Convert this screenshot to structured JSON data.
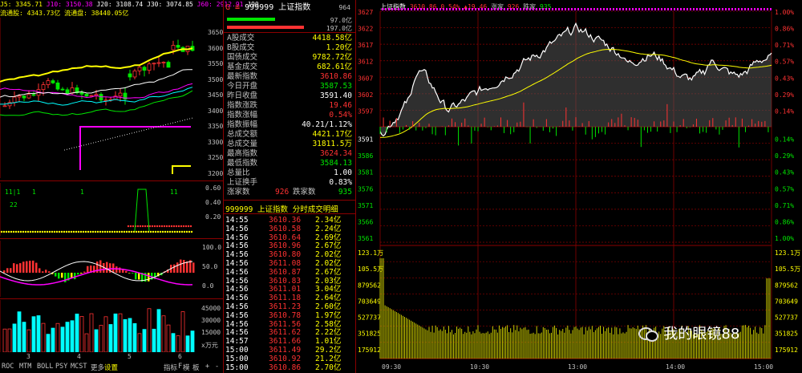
{
  "left_chart": {
    "header": {
      "items": [
        {
          "text": "J5: 3345.71",
          "color": "#ffff00"
        },
        {
          "text": "J10: 3150.38",
          "color": "#ff00ff"
        },
        {
          "text": "J20: 3108.74",
          "color": "#ffffff"
        },
        {
          "text": "J30: 3074.85",
          "color": "#ffffff"
        },
        {
          "text": "J60: 2912.91",
          "color": "#ff00ff"
        },
        {
          "text": "J90",
          "color": "#ffffff"
        }
      ],
      "line2": [
        {
          "text": "流通股: 4343.73亿",
          "color": "#ffff00"
        },
        {
          "text": "流通盘: 38440.05亿",
          "color": "#ffff00"
        }
      ]
    },
    "price_axis": [
      "3650",
      "3600",
      "3550",
      "3500",
      "3450",
      "3400",
      "3350",
      "3300",
      "3250",
      "3200"
    ],
    "kdj_axis": [
      "0.60",
      "0.40",
      "0.20"
    ],
    "kdj_markers": [
      "11|1",
      "22",
      "1",
      "11",
      "1"
    ],
    "macd_axis": [
      "100.0",
      "50.0",
      "0.0"
    ],
    "vol_axis": [
      "45000",
      "30000",
      "15000",
      "x万元"
    ],
    "month_ticks": [
      "3",
      "4",
      "5",
      "6"
    ],
    "bottom_tabs": [
      "ROC",
      "MTM",
      "BOLL",
      "PSY",
      "MCST",
      "更多",
      "设置"
    ],
    "right_tabs": [
      "指标",
      "F",
      "模",
      "板",
      "+",
      "-"
    ]
  },
  "quote_panel": {
    "title_code": "999999",
    "title_name": "上证指数",
    "title_prefix": "G ≡",
    "title_badge": "964",
    "bar_labels": [
      "97.0亿",
      "197.0亿"
    ],
    "rows": [
      {
        "label": "A股成交",
        "value": "4418.58亿",
        "color": "#ffff00"
      },
      {
        "label": "B股成交",
        "value": "1.20亿",
        "color": "#ffff00"
      },
      {
        "label": "国债成交",
        "value": "9782.72亿",
        "color": "#ffff00"
      },
      {
        "label": "基金成交",
        "value": "682.61亿",
        "color": "#ffff00"
      },
      {
        "label": "最新指数",
        "value": "3610.86",
        "color": "#ff3232"
      },
      {
        "label": "今日开盘",
        "value": "3587.53",
        "color": "#00e600"
      },
      {
        "label": "昨日收盘",
        "value": "3591.40",
        "color": "#ffffff"
      },
      {
        "label": "指数涨跌",
        "value": "19.46",
        "color": "#ff3232"
      },
      {
        "label": "指数涨幅",
        "value": "0.54%",
        "color": "#ff3232"
      },
      {
        "label": "指数振幅",
        "value": "40.21/1.12%",
        "color": "#ffffff"
      },
      {
        "label": "总成交额",
        "value": "4421.17亿",
        "color": "#ffff00"
      },
      {
        "label": "总成交量",
        "value": "31811.5万",
        "color": "#ffff00"
      },
      {
        "label": "最高指数",
        "value": "3624.34",
        "color": "#ff3232"
      },
      {
        "label": "最低指数",
        "value": "3584.13",
        "color": "#00e600"
      },
      {
        "label": "总量比",
        "value": "1.00",
        "color": "#ffffff"
      },
      {
        "label": "上证换手",
        "value": "0.83%",
        "color": "#ffffff"
      }
    ],
    "rise_label": "涨家数",
    "rise_value": "926",
    "fall_label": "跌家数",
    "fall_value": "935",
    "ticks_title": "999999 上证指数  分时成交明细",
    "ticks": [
      {
        "time": "14:55",
        "price": "3610.36",
        "vol": "2.34亿"
      },
      {
        "time": "14:56",
        "price": "3610.58",
        "vol": "2.24亿"
      },
      {
        "time": "14:56",
        "price": "3610.64",
        "vol": "2.69亿"
      },
      {
        "time": "14:56",
        "price": "3610.96",
        "vol": "2.67亿"
      },
      {
        "time": "14:56",
        "price": "3610.80",
        "vol": "2.02亿"
      },
      {
        "time": "14:56",
        "price": "3611.08",
        "vol": "2.02亿"
      },
      {
        "time": "14:56",
        "price": "3610.87",
        "vol": "2.67亿"
      },
      {
        "time": "14:56",
        "price": "3610.83",
        "vol": "2.03亿"
      },
      {
        "time": "14:56",
        "price": "3611.01",
        "vol": "3.04亿"
      },
      {
        "time": "14:56",
        "price": "3611.18",
        "vol": "2.64亿"
      },
      {
        "time": "14:56",
        "price": "3611.23",
        "vol": "2.60亿"
      },
      {
        "time": "14:56",
        "price": "3610.78",
        "vol": "1.97亿"
      },
      {
        "time": "14:56",
        "price": "3611.56",
        "vol": "2.58亿"
      },
      {
        "time": "14:56",
        "price": "3611.62",
        "vol": "2.22亿"
      },
      {
        "time": "14:57",
        "price": "3611.66",
        "vol": "1.01亿"
      },
      {
        "time": "15:00",
        "price": "3611.49",
        "vol": "29.2亿"
      },
      {
        "time": "15:00",
        "price": "3610.92",
        "vol": "21.2亿"
      },
      {
        "time": "15:00",
        "price": "3610.86",
        "vol": "2.70亿"
      }
    ]
  },
  "intraday": {
    "legend": {
      "name": "上证指数",
      "price": "3610.86",
      "pct": "0.54%",
      "chg": "▲19.46",
      "up_label": "涨家",
      "up_count": "926",
      "down_label": "跌家",
      "down_count": "935"
    },
    "price_ticks_left": [
      "3627",
      "3622",
      "3617",
      "3612",
      "3607",
      "3602",
      "3597",
      "3591",
      "3586",
      "3581",
      "3576",
      "3571",
      "3566",
      "3561"
    ],
    "pct_ticks_right": [
      "1.00%",
      "0.86%",
      "0.71%",
      "0.57%",
      "0.43%",
      "0.29%",
      "0.14%",
      "0.14%",
      "0.29%",
      "0.43%",
      "0.57%",
      "0.71%",
      "0.86%",
      "1.00%"
    ],
    "vol_ticks": [
      "123.1万",
      "105.5万",
      "879562",
      "703649",
      "527737",
      "351825",
      "175912"
    ],
    "time_ticks": [
      "09:30",
      "10:30",
      "13:00",
      "14:00",
      "15:00"
    ],
    "watermark": "我的眼镜88",
    "prev_close": 3591.4,
    "pct_max": 1.0
  },
  "colors": {
    "up": "#ff3232",
    "down": "#00e600",
    "grid": "#8b0000",
    "avg": "#ffff00",
    "price": "#ffffff"
  }
}
